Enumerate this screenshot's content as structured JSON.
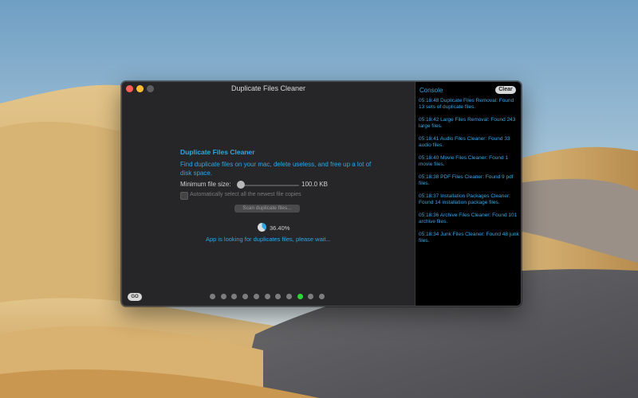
{
  "window": {
    "title": "Duplicate Files Cleaner"
  },
  "main": {
    "heading": "Duplicate Files Cleaner",
    "description": "Find duplicate files on your mac, delete useless, and free up a lot of disk space.",
    "min_size_label": "Minimum file size:",
    "min_size_value": "100.0 KB",
    "min_size_slider_fraction": 0.0,
    "auto_select_label": "Automatically select all the newest file copies",
    "auto_select_checked": false,
    "scan_button": "Scan duplicate files...",
    "progress_text": "36.40%",
    "progress_value": 36.4,
    "status_text": "App is looking for duplicates files, please wait...",
    "go_button": "GO",
    "page_count": 11,
    "active_page": 9
  },
  "console": {
    "title": "Console",
    "clear_button": "Clear",
    "entries": [
      "05:18:48 Duplicate Files Removal: Found 13 sets of duplicate files.",
      "05:18:42 Large Files Removal: Found 243 large files.",
      "05:18:41 Audio Files Cleaner: Found 33 audio files.",
      "05:18:40 Movie Files Cleaner: Found 1 movie files.",
      "05:18:38 PDF Files Cleaner: Found 9 pdf files.",
      "05:18:37 Installation Packages Cleaner: Found 14 installation package files.",
      "05:18:36 Archive Files Cleaner: Found 101 archive files.",
      "05:18:34 Junk Files Cleaner: Found 48 junk files."
    ]
  },
  "colors": {
    "accent": "#29a8e8",
    "active_dot": "#2ad833",
    "close": "#ff5f57",
    "minimize": "#febc2e"
  }
}
